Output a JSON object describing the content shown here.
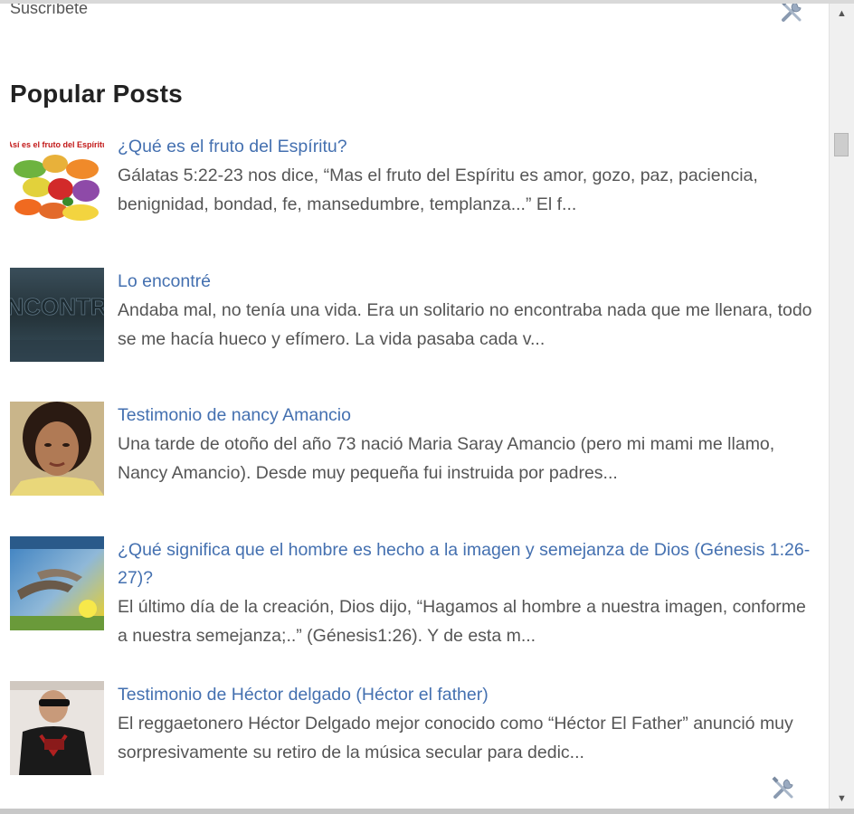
{
  "top": {
    "subscribe_label": "Suscríbete"
  },
  "widget": {
    "title": "Popular Posts"
  },
  "posts": [
    {
      "title": "¿Qué es el fruto del Espíritu?",
      "snippet": "Gálatas 5:22-23 nos dice, “Mas el fruto del Espíritu es amor, gozo, paz, paciencia, benignidad, bondad, fe, mansedumbre, templanza...” El f...",
      "thumb_caption": "Así es el fruto del Espíritu"
    },
    {
      "title": "Lo encontré",
      "snippet": "Andaba mal, no tenía una vida. Era un solitario no encontraba nada que me llenara, todo se me hacía hueco y efímero. La vida pasaba cada v...",
      "thumb_caption": "ENCONTRÉ"
    },
    {
      "title": "Testimonio de nancy Amancio",
      "snippet": "Una tarde de otoño del año 73 nació Maria Saray Amancio (pero mi mami me llamo, Nancy Amancio). Desde muy pequeña fui instruida por padres..."
    },
    {
      "title": "¿Qué significa que el hombre es hecho a la imagen y semejanza de Dios (Génesis 1:26-27)?",
      "snippet": "El último día de la creación, Dios dijo, “Hagamos al hombre a nuestra imagen, conforme a nuestra semejanza;..” (Génesis1:26). Y de esta m..."
    },
    {
      "title": "Testimonio de Héctor delgado (Héctor el father)",
      "snippet": "El reggaetonero Héctor Delgado mejor conocido como “Héctor El Father” anunció muy sorpresivamente su retiro de la música secular para dedic..."
    }
  ],
  "icons": {
    "edit_widget": "wrench-screwdriver-icon",
    "scroll_up": "triangle-up-icon",
    "scroll_down": "triangle-down-icon"
  },
  "colors": {
    "link": "#4470b0",
    "text": "#555555",
    "heading": "#222222"
  }
}
